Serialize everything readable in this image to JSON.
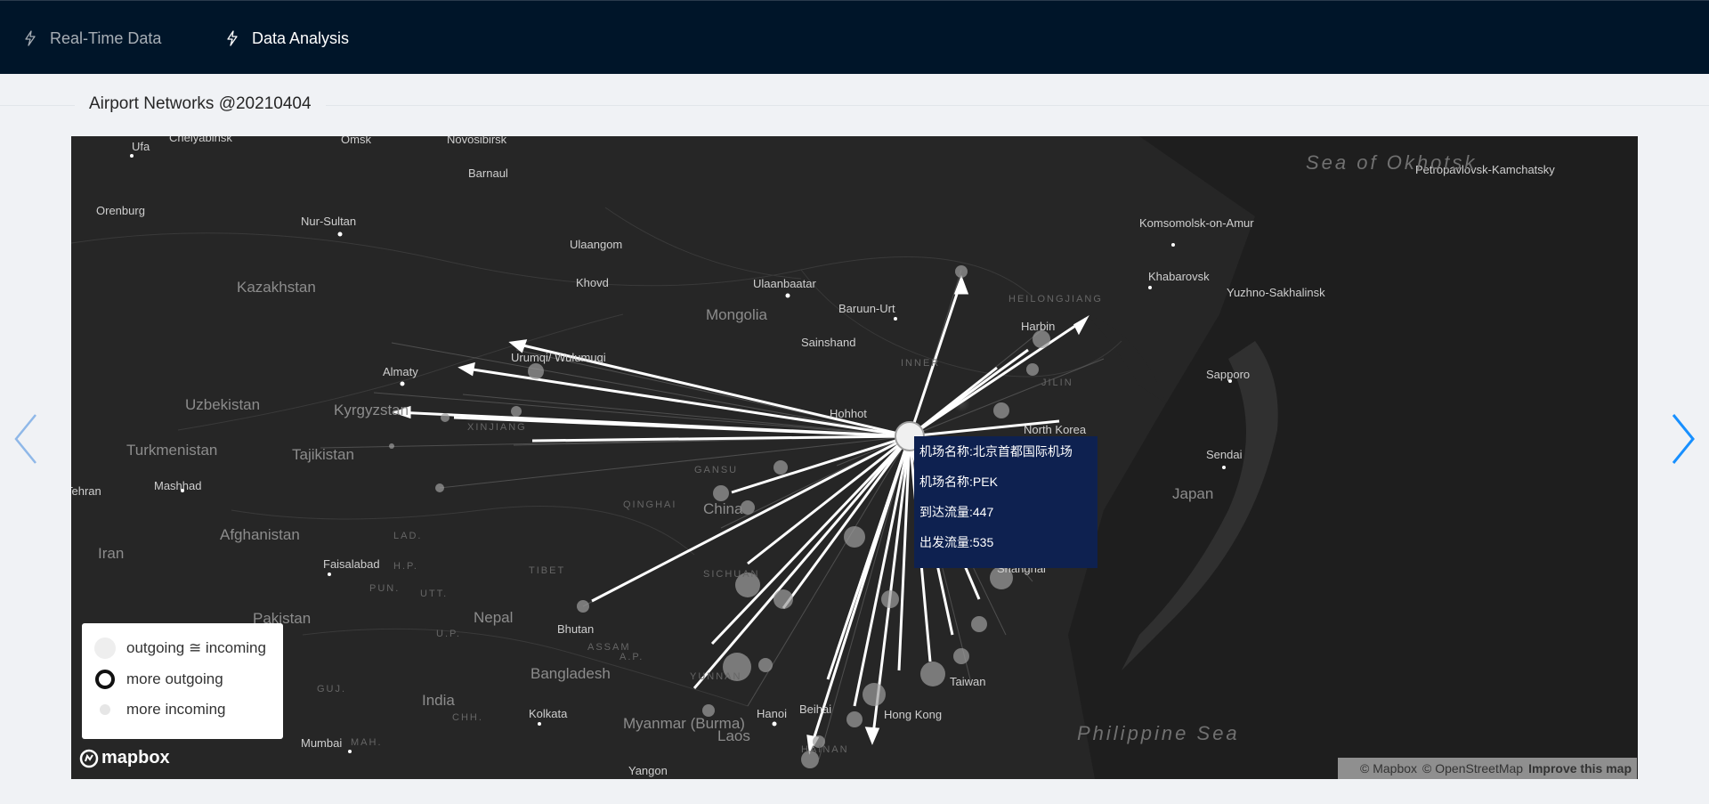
{
  "nav": {
    "items": [
      {
        "label": "Real-Time Data",
        "active": false
      },
      {
        "label": "Data Analysis",
        "active": true
      }
    ]
  },
  "page": {
    "title": "Airport Networks @20210404"
  },
  "map": {
    "countries": [
      "Kazakhstan",
      "Mongolia",
      "Uzbekistan",
      "Kyrgyzstan",
      "Turkmenistan",
      "Tajikistan",
      "Afghanistan",
      "Iran",
      "Pakistan",
      "Nepal",
      "India",
      "Bangladesh",
      "Bhutan",
      "Myanmar (Burma)",
      "Laos",
      "China",
      "Japan",
      "North Korea",
      "Taiwan"
    ],
    "cities": [
      "Ufa",
      "Chelyabinsk",
      "Omsk",
      "Novosibirsk",
      "Barnaul",
      "Orenburg",
      "Nur-Sultan",
      "Ulaangom",
      "Khovd",
      "Ulaanbaatar",
      "Baruun-Urt",
      "Sainshand",
      "Almaty",
      "Urumqi/ Wulumuqi",
      "Hohhot",
      "Harbin",
      "Mashhad",
      "Faisalabad",
      "Kolkata",
      "Hanoi",
      "Hong Kong",
      "Shanghai",
      "Mumbai",
      "Yangon",
      "Sapporo",
      "Sendai",
      "Khabarovsk",
      "Komsomolsk-on-Amur",
      "Yuzhno-Sakhalinsk",
      "Petropavlovsk-Kamchatsky",
      "Tehran",
      "Beihai"
    ],
    "seas": [
      "Sea of Okhotsk",
      "Philippine Sea"
    ],
    "regions": [
      "XINJIANG",
      "QINGHAI",
      "GANSU",
      "TIBET",
      "SICHUAN",
      "YUNNAN",
      "INNER",
      "HEILONGJIANG",
      "JILIN",
      "ASSAM",
      "H.P.",
      "PUN.",
      "UTT.",
      "LAD.",
      "U.P.",
      "GUJ.",
      "MAH.",
      "CHH.",
      "A.P.",
      "HAINAN"
    ]
  },
  "tooltip": {
    "rows": [
      {
        "label": "机场名称:",
        "value": "北京首都国际机场"
      },
      {
        "label": "机场名称:",
        "value": "PEK"
      },
      {
        "label": "到达流量:",
        "value": "447"
      },
      {
        "label": "出发流量:",
        "value": "535"
      }
    ]
  },
  "legend": {
    "items": [
      {
        "label": "outgoing ≅ incoming"
      },
      {
        "label": "more outgoing"
      },
      {
        "label": "more incoming"
      }
    ]
  },
  "attribution": {
    "mapbox": "© Mapbox",
    "osm": "© OpenStreetMap",
    "improve": "Improve this map",
    "logo": "mapbox"
  },
  "colors": {
    "topbar": "#001529",
    "map_bg": "#262626",
    "tooltip_bg": "#0e2150",
    "arrow": "#1890ff"
  },
  "icons": [
    "thunderbolt-icon",
    "chevron-left-icon",
    "chevron-right-icon",
    "mapbox-logo-icon"
  ]
}
